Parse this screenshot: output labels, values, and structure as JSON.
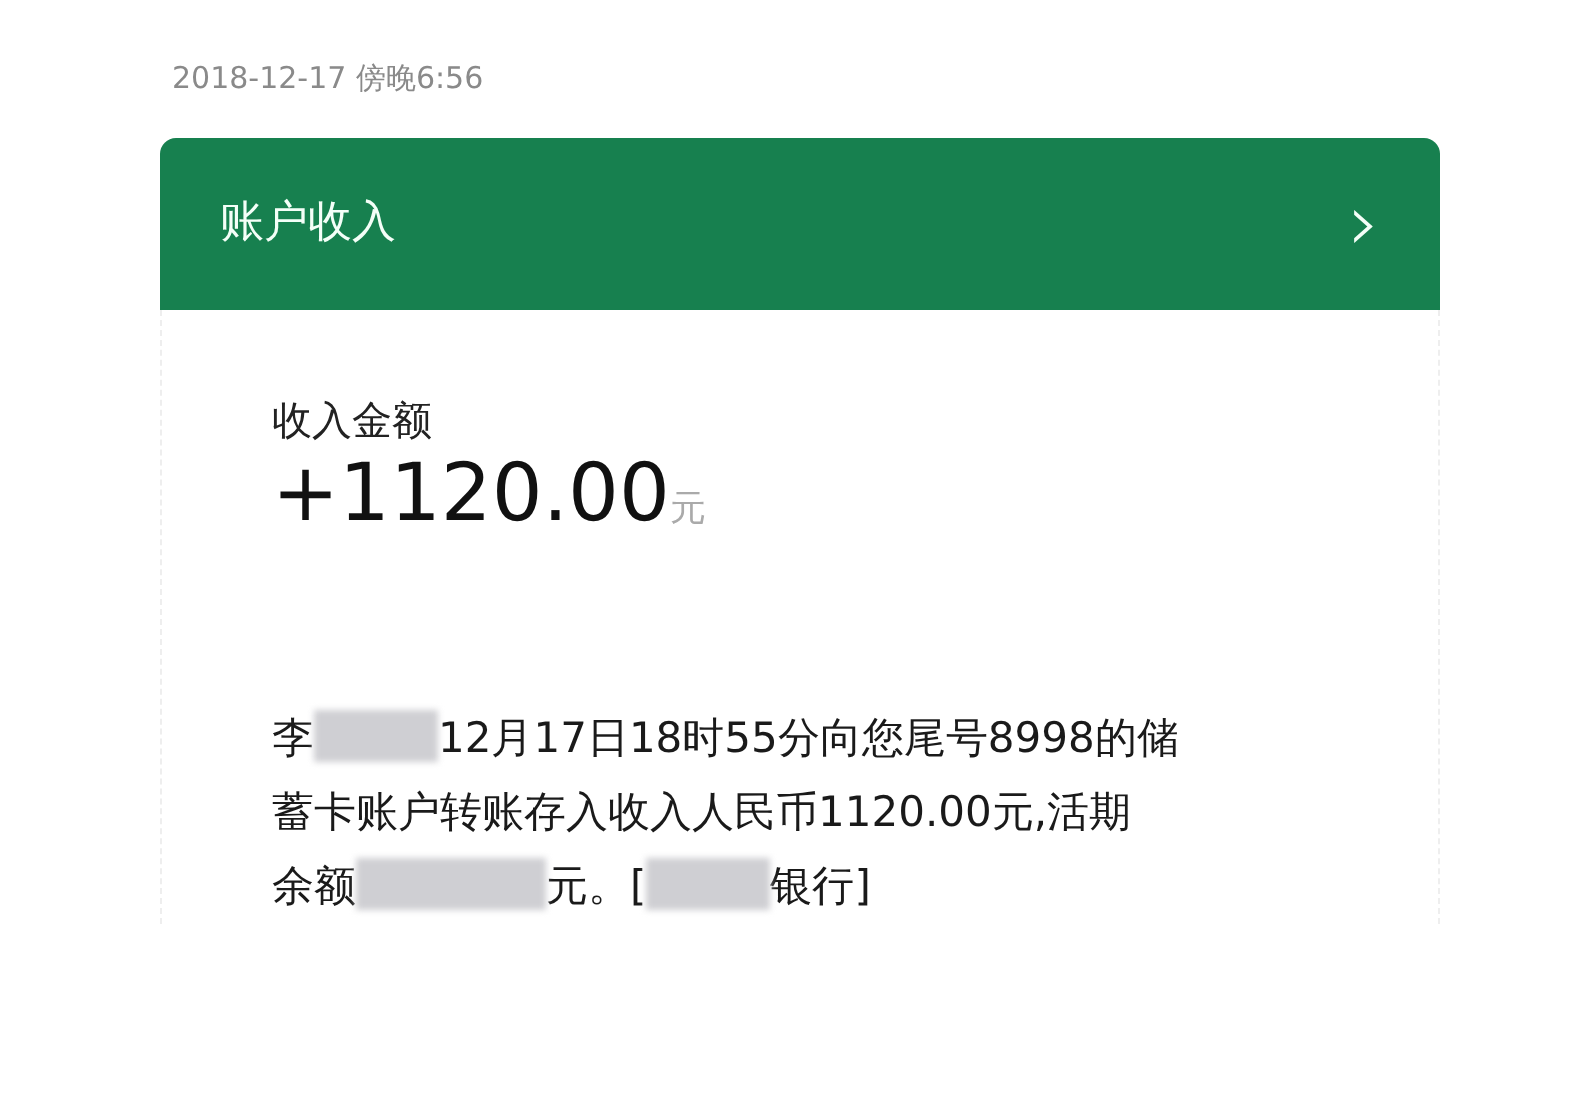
{
  "timestamp": "2018-12-17 傍晚6:56",
  "header": {
    "title": "账户收入",
    "chevron": "›"
  },
  "income": {
    "label": "收入金额",
    "amount": "+1120.00",
    "unit": "元"
  },
  "message": {
    "lines": [
      [
        {
          "kind": "text",
          "text": "李"
        },
        {
          "kind": "redacted"
        },
        {
          "kind": "text",
          "text": "12月17日18时55分向您尾号8998的储"
        }
      ],
      [
        {
          "kind": "text",
          "text": "蓄卡账户转账存入收入人民币1120.00元,活期"
        }
      ],
      [
        {
          "kind": "text",
          "text": "余额"
        },
        {
          "kind": "redacted",
          "wide": true
        },
        {
          "kind": "text",
          "text": "元。["
        },
        {
          "kind": "redacted"
        },
        {
          "kind": "text",
          "text": "银行]"
        }
      ]
    ]
  }
}
